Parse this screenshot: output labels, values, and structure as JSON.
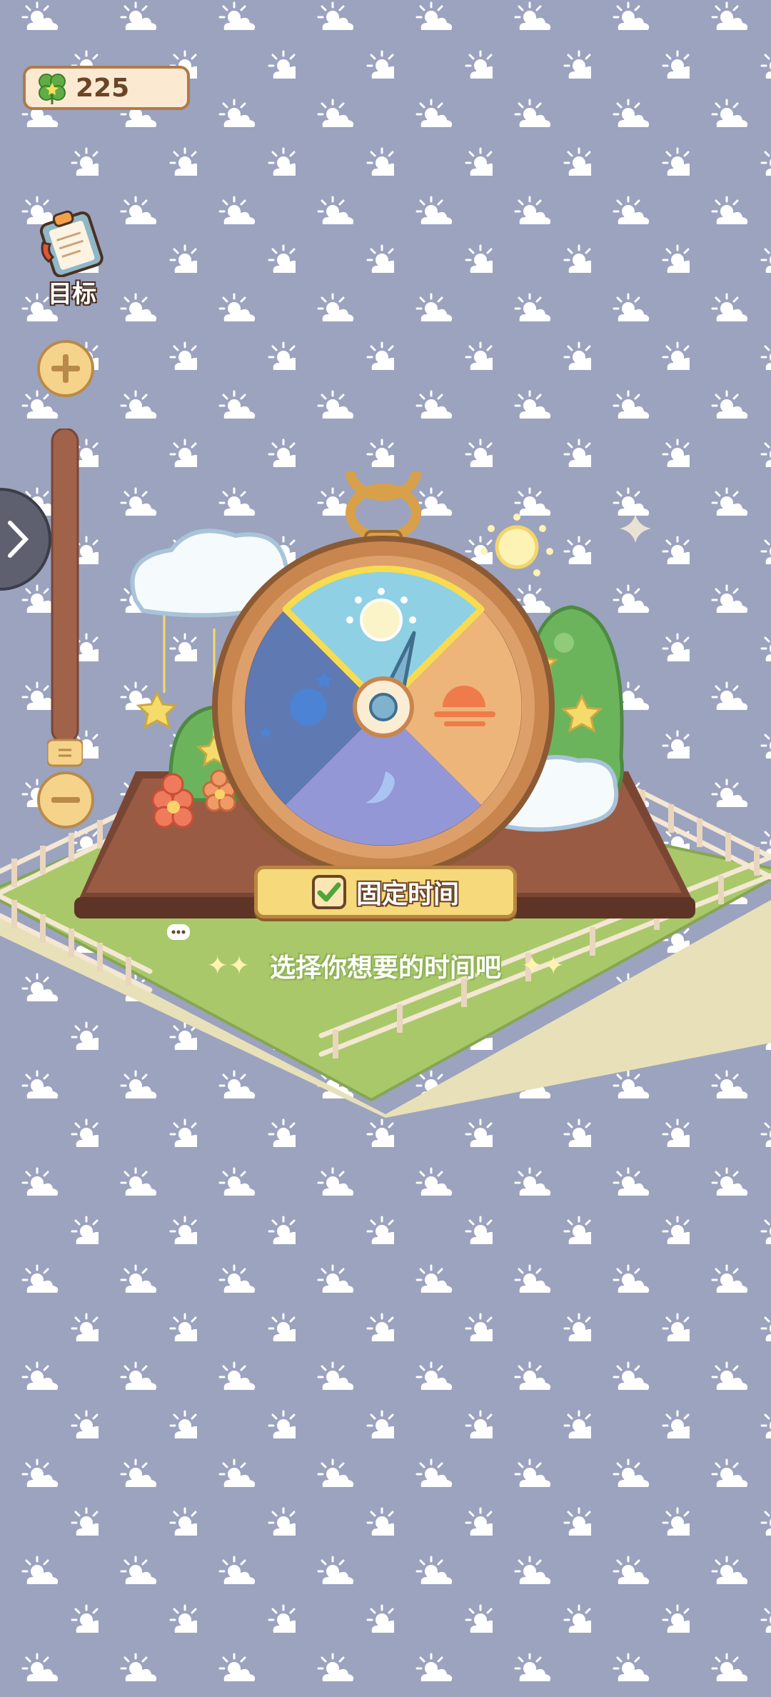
{
  "hud": {
    "clover_count": "225",
    "goal_label": "目标"
  },
  "clock_panel": {
    "fixed_time_label": "固定时间",
    "fixed_time_checked": true,
    "hint": "选择你想要的时间吧",
    "segments": [
      "day",
      "evening",
      "night",
      "late-night"
    ],
    "selected_segment": "day"
  },
  "icons": {
    "currency": "clover-icon",
    "goal": "clipboard-icon",
    "zoom_in": "plus-icon",
    "zoom_out": "minus-icon",
    "side": "chevron-right-icon"
  },
  "colors": {
    "background": "#9ba3bf",
    "grass": "#a9c86a",
    "highlight": "#f7dc4f"
  }
}
